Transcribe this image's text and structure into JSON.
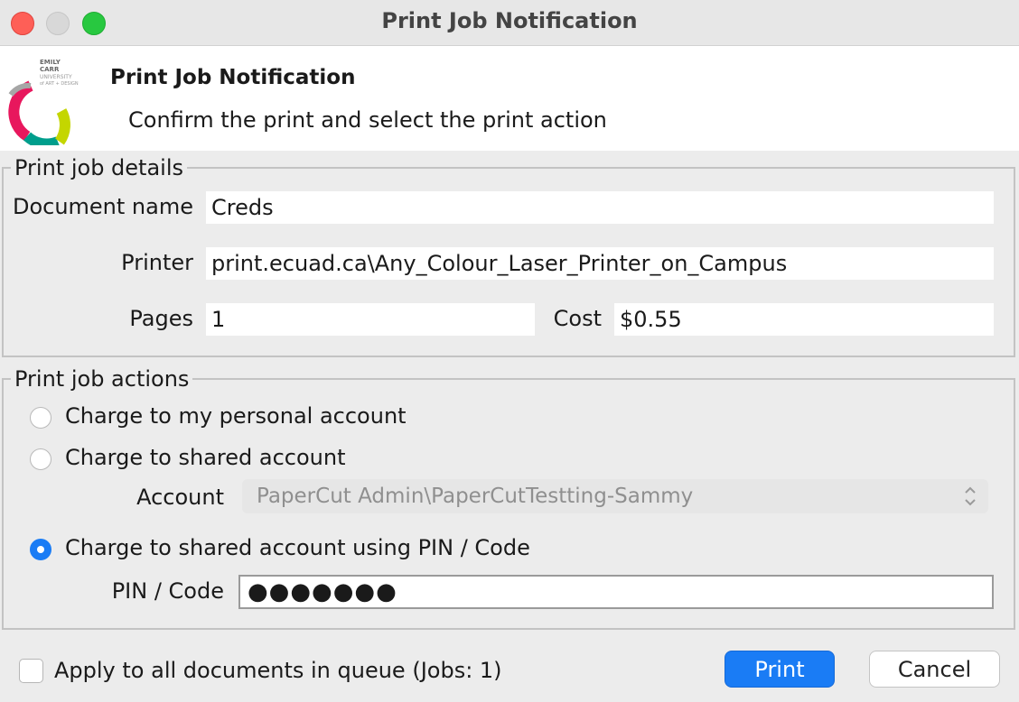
{
  "window": {
    "title": "Print Job Notification"
  },
  "header": {
    "title": "Print Job Notification",
    "subtitle": "Confirm the print and select the print action",
    "logo_text": [
      "EMILY",
      "CARR",
      "UNIVERSITY",
      "of ART + DESIGN"
    ]
  },
  "details": {
    "legend": "Print job details",
    "document_label": "Document name",
    "document_value": "Creds",
    "printer_label": "Printer",
    "printer_value": "print.ecuad.ca\\Any_Colour_Laser_Printer_on_Campus",
    "pages_label": "Pages",
    "pages_value": "1",
    "cost_label": "Cost",
    "cost_value": "$0.55"
  },
  "actions": {
    "legend": "Print job actions",
    "options": [
      {
        "label": "Charge to my personal account",
        "selected": false
      },
      {
        "label": "Charge to shared account",
        "selected": false
      },
      {
        "label": "Charge to shared account using PIN / Code",
        "selected": true
      }
    ],
    "account_label": "Account",
    "account_value": "PaperCut Admin\\PaperCutTestting-Sammy",
    "pin_label": "PIN / Code",
    "pin_value": "●●●●●●●"
  },
  "footer": {
    "apply_all_label": "Apply to all documents in queue (Jobs: 1)",
    "apply_all_checked": false,
    "print_label": "Print",
    "cancel_label": "Cancel"
  },
  "colors": {
    "accent": "#1a7cf5",
    "close": "#fe5f57",
    "maximize": "#28c840"
  }
}
